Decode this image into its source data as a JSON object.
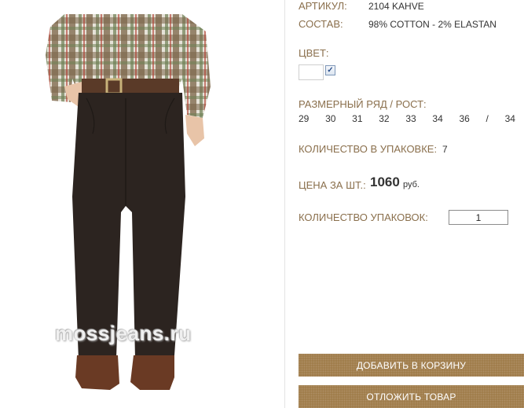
{
  "product": {
    "article_label": "АРТИКУЛ:",
    "article_value": "2104 KAHVE",
    "composition_label": "СОСТАВ:",
    "composition_value": "98% COTTON - 2% ELASTAN",
    "color_label": "ЦВЕТ:",
    "color_check_glyph": "✓",
    "size_label": "РАЗМЕРНЫЙ РЯД / РОСТ:",
    "sizes": [
      "29",
      "30",
      "31",
      "32",
      "33",
      "34",
      "36",
      "/",
      "34"
    ],
    "pack_qty_label": "КОЛИЧЕСТВО В УПАКОВКЕ:",
    "pack_qty_value": "7",
    "price_label": "ЦЕНА ЗА ШТ.:",
    "price_value": "1060",
    "price_currency": "руб.",
    "packs_label": "КОЛИЧЕСТВО УПАКОВОК:",
    "packs_value": "1"
  },
  "photo": {
    "watermark": "mossjeans.ru"
  },
  "actions": {
    "add_to_cart": "ДОБАВИТЬ В КОРЗИНУ",
    "defer": "ОТЛОЖИТЬ ТОВАР"
  },
  "colors": {
    "label": "#8a6f4c",
    "button": "#9e7a47"
  }
}
